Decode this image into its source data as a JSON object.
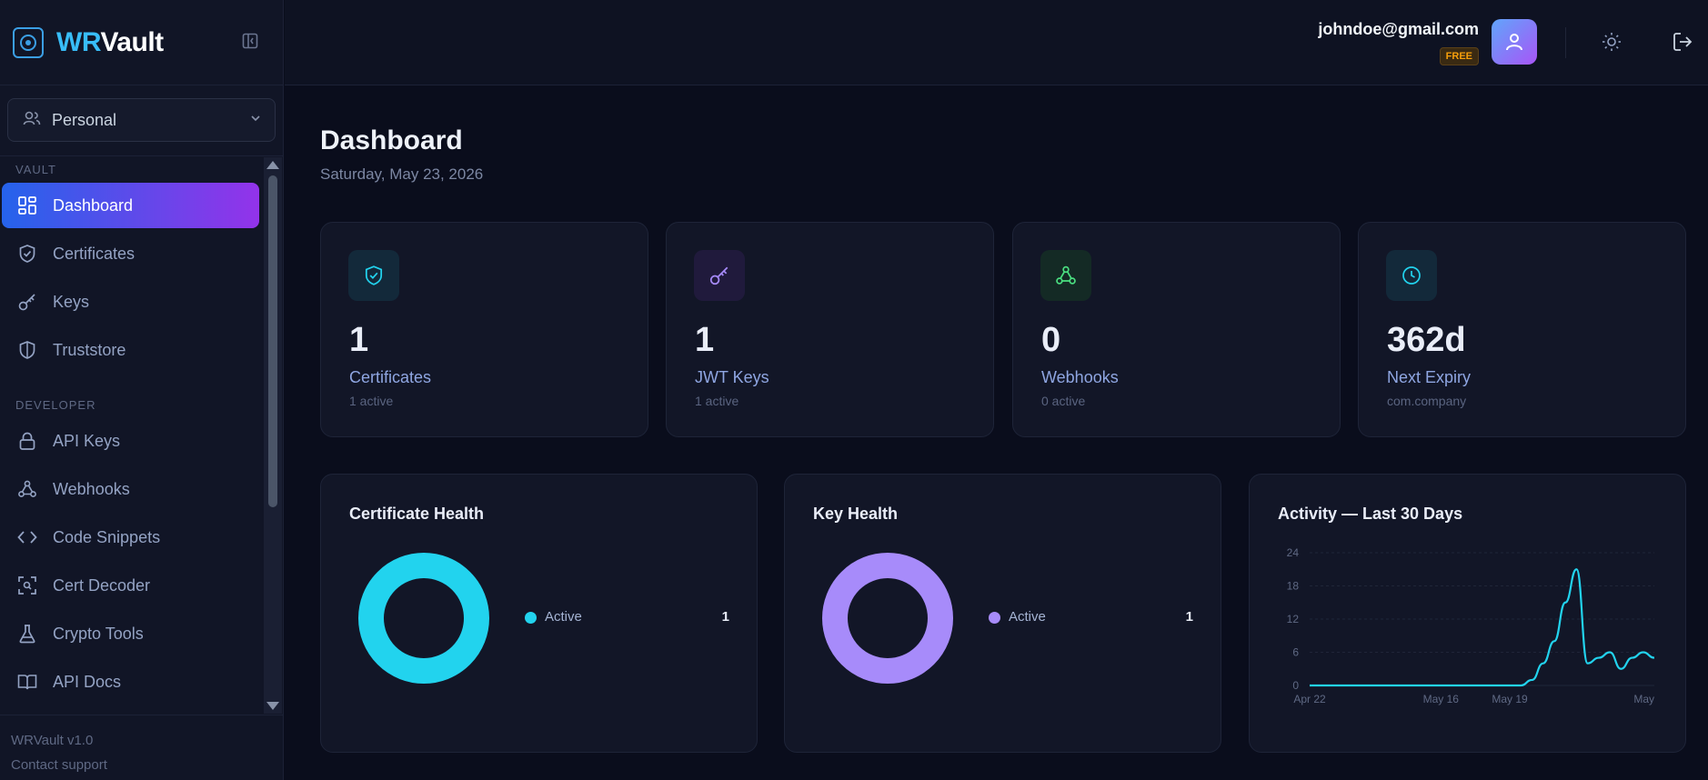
{
  "brand": {
    "prefix": "WR",
    "suffix": "Vault"
  },
  "workspace": {
    "selected": "Personal"
  },
  "sidebar": {
    "sections": [
      {
        "label": "VAULT",
        "items": [
          {
            "label": "Dashboard",
            "icon": "dashboard-icon",
            "active": true
          },
          {
            "label": "Certificates",
            "icon": "shield-check-icon"
          },
          {
            "label": "Keys",
            "icon": "key-icon"
          },
          {
            "label": "Truststore",
            "icon": "shield-icon"
          }
        ]
      },
      {
        "label": "DEVELOPER",
        "items": [
          {
            "label": "API Keys",
            "icon": "lock-icon"
          },
          {
            "label": "Webhooks",
            "icon": "webhook-icon"
          },
          {
            "label": "Code Snippets",
            "icon": "code-icon"
          },
          {
            "label": "Cert Decoder",
            "icon": "scan-icon"
          },
          {
            "label": "Crypto Tools",
            "icon": "flask-icon"
          },
          {
            "label": "API Docs",
            "icon": "book-icon"
          }
        ]
      }
    ],
    "footer": {
      "version": "WRVault v1.0",
      "support": "Contact support"
    }
  },
  "header": {
    "email": "johndoe@gmail.com",
    "plan": "FREE"
  },
  "page": {
    "title": "Dashboard",
    "date": "Saturday, May 23, 2026"
  },
  "stats": [
    {
      "value": "1",
      "label": "Certificates",
      "sub": "1 active",
      "icon": "shield-check-icon",
      "color": "#22d3ee"
    },
    {
      "value": "1",
      "label": "JWT Keys",
      "sub": "1 active",
      "icon": "key-icon",
      "color": "#a78bfa"
    },
    {
      "value": "0",
      "label": "Webhooks",
      "sub": "0 active",
      "icon": "webhook-icon",
      "color": "#4ade80"
    },
    {
      "value": "362d",
      "label": "Next Expiry",
      "sub": "com.company",
      "icon": "clock-icon",
      "color": "#22d3ee"
    }
  ],
  "panels": {
    "cert_health": {
      "title": "Certificate Health",
      "legend": [
        {
          "name": "Active",
          "value": "1",
          "color": "#22d3ee"
        }
      ]
    },
    "key_health": {
      "title": "Key Health",
      "legend": [
        {
          "name": "Active",
          "value": "1",
          "color": "#a78bfa"
        }
      ]
    },
    "activity": {
      "title": "Activity — Last 30 Days"
    }
  },
  "chart_data": [
    {
      "type": "pie",
      "title": "Certificate Health",
      "categories": [
        "Active"
      ],
      "values": [
        1
      ],
      "colors": [
        "#22d3ee"
      ]
    },
    {
      "type": "pie",
      "title": "Key Health",
      "categories": [
        "Active"
      ],
      "values": [
        1
      ],
      "colors": [
        "#a78bfa"
      ]
    },
    {
      "type": "line",
      "title": "Activity — Last 30 Days",
      "x_tick_labels": [
        "Apr 22",
        "May 16",
        "May 19",
        "May"
      ],
      "y_ticks": [
        0,
        6,
        12,
        18,
        24
      ],
      "ylim": [
        0,
        24
      ],
      "grid": true,
      "color": "#22d3ee",
      "x": [
        "Apr 22",
        "Apr 23",
        "Apr 24",
        "Apr 25",
        "Apr 26",
        "Apr 27",
        "Apr 28",
        "Apr 29",
        "Apr 30",
        "May 1",
        "May 2",
        "May 3",
        "May 4",
        "May 5",
        "May 6",
        "May 7",
        "May 8",
        "May 9",
        "May 10",
        "May 11",
        "May 12",
        "May 13",
        "May 14",
        "May 15",
        "May 16",
        "May 17",
        "May 18",
        "May 19",
        "May 20",
        "May 21",
        "May 22",
        "May 23"
      ],
      "values": [
        0,
        0,
        0,
        0,
        0,
        0,
        0,
        0,
        0,
        0,
        0,
        0,
        0,
        0,
        0,
        0,
        0,
        0,
        0,
        0,
        1,
        4,
        8,
        15,
        21,
        4,
        5,
        6,
        3,
        5,
        6,
        5
      ]
    }
  ]
}
